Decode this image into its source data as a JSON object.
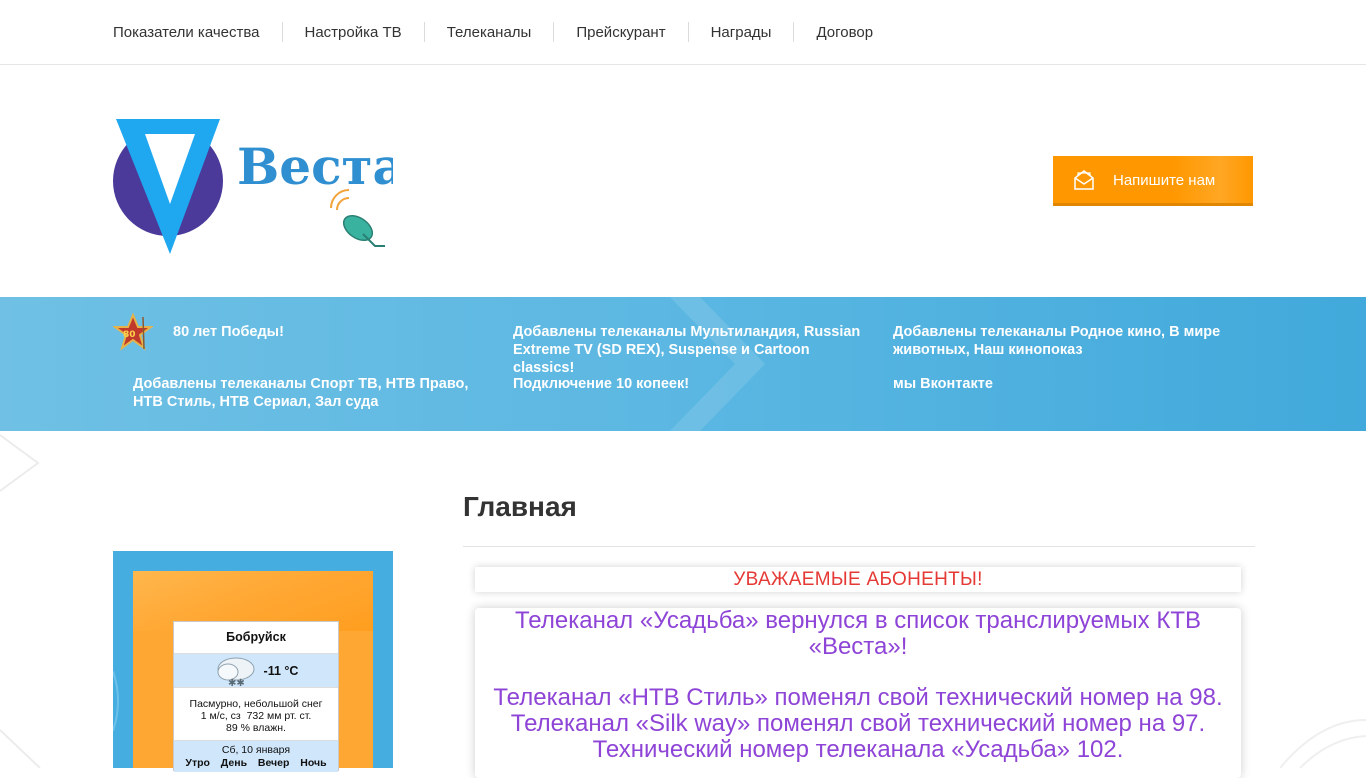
{
  "nav": {
    "items": [
      {
        "label": "Показатели качества"
      },
      {
        "label": "Настройка ТВ"
      },
      {
        "label": "Телеканалы"
      },
      {
        "label": "Прейскурант"
      },
      {
        "label": "Награды"
      },
      {
        "label": "Договор"
      }
    ]
  },
  "header": {
    "logo_text": "Веста",
    "write_button": "Напишите нам",
    "brand_purple": "#4b3a9a",
    "brand_blue": "#2f8fd0",
    "accent_orange": "#ff9800"
  },
  "news": {
    "items": [
      {
        "text": "80 лет Победы!"
      },
      {
        "text": "Добавлены телеканалы Мультиландия, Russian Extreme TV (SD REX), Suspense и Cartoon classics!"
      },
      {
        "text": "Добавлены телеканалы Родное кино, В мире животных, Наш кинопоказ"
      },
      {
        "text": "Добавлены телеканалы Спорт ТВ, НТВ Право, НТВ Стиль, НТВ Сериал, Зал суда"
      },
      {
        "text": "Подключение 10 копеек!"
      },
      {
        "text": "мы Вконтакте"
      }
    ]
  },
  "weather": {
    "city": "Бобруйск",
    "temperature": "-11 °С",
    "icon": "cloud-snow-icon",
    "description": "Пасмурно, небольшой снег",
    "wind": "1 м/с, сз",
    "pressure": "732 мм рт. ст.",
    "humidity": "89 % влажн.",
    "date": "Сб, 10 января",
    "dayparts": [
      "Утро",
      "День",
      "Вечер",
      "Ночь"
    ]
  },
  "main": {
    "title": "Главная",
    "notice_heading": "УВАЖАЕМЫЕ АБОНЕНТЫ!",
    "notice_lines": [
      "Телеканал «Усадьба» вернулся в список транслируемых КТВ «Веста»!",
      "Телеканал «НТВ Стиль» поменял свой технический номер на 98.",
      "Телеканал «Silk way» поменял свой технический номер на 97.",
      "Технический номер телеканала «Усадьба» 102."
    ],
    "heading_color": "#e53935",
    "text_color": "#8e44d6"
  }
}
